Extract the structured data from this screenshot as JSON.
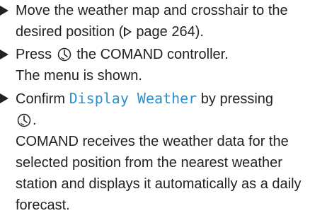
{
  "steps": [
    {
      "text_before": "Move the weather map and crosshair to the desired position (",
      "page_ref": "page 264",
      "text_after": ").",
      "ref_icon": "triangle-right-outline-icon"
    },
    {
      "text_before": "Press",
      "icon": "controller-press-icon",
      "text_after": "the COMAND controller.",
      "result": "The menu is shown."
    },
    {
      "text_before": "Confirm",
      "display_text": "Display Weather",
      "text_after": "by pressing",
      "icon": "controller-press-icon",
      "text_end": ".",
      "result": "COMAND receives the weather data for the selected position from the nearest weather station and displays it automatically as a daily forecast."
    }
  ],
  "colors": {
    "text": "#222222",
    "display_text": "#2a8fd0"
  }
}
